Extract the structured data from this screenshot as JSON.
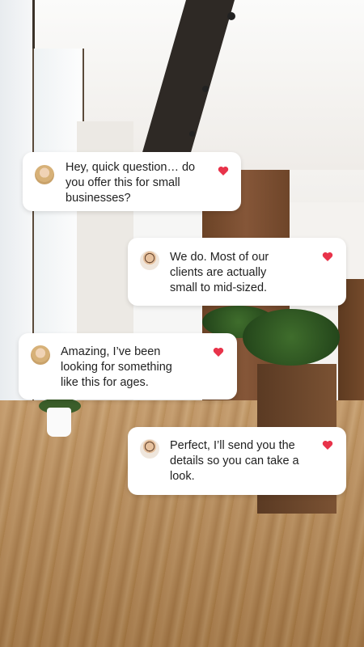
{
  "colors": {
    "heart": "#e8334a",
    "bubble": "#ffffff",
    "text": "#1f1f1f"
  },
  "messages": [
    {
      "sender": "female-customer",
      "avatar_icon": "female-avatar-icon",
      "lines": [
        "Hey, quick question… do",
        "you offer this for small",
        "businesses?"
      ],
      "liked": true
    },
    {
      "sender": "male-agent",
      "avatar_icon": "male-avatar-icon",
      "lines": [
        "We do. Most of our",
        "clients are actually",
        "small to mid-sized."
      ],
      "liked": true
    },
    {
      "sender": "female-customer",
      "avatar_icon": "female-avatar-icon",
      "lines": [
        "Amazing, I’ve been",
        "looking for something",
        "like this for ages."
      ],
      "liked": true
    },
    {
      "sender": "male-agent",
      "avatar_icon": "male-avatar-icon",
      "lines": [
        "Perfect, I’ll send you the",
        "details so you can take a",
        "look."
      ],
      "liked": true
    }
  ]
}
